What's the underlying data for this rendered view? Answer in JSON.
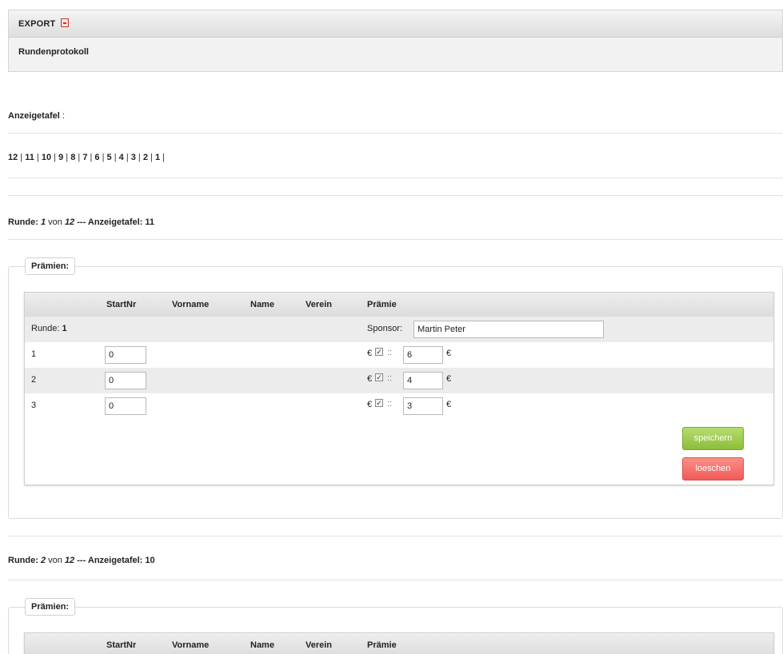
{
  "export": {
    "title": "EXPORT",
    "icon": "pdf-icon",
    "item": "Rundenprotokoll"
  },
  "anzeigetafel": {
    "label": "Anzeigetafel",
    "suffix": " :",
    "numbers": [
      "12",
      "11",
      "10",
      "9",
      "8",
      "7",
      "6",
      "5",
      "4",
      "3",
      "2",
      "1"
    ],
    "separator": " | "
  },
  "rounds": [
    {
      "runde_label": "Runde: ",
      "runde_num": "1",
      "von": " von ",
      "total": "12",
      "dash": " --- ",
      "tafel_label": "Anzeigetafel: ",
      "tafel_num": "11",
      "legend": "Prämien:",
      "columns": [
        "StartNr",
        "Vorname",
        "Name",
        "Verein",
        "Prämie"
      ],
      "round_row_label": "Runde: ",
      "round_row_num": "1",
      "sponsor_label": "Sponsor:",
      "sponsor_value": "Martin Peter",
      "rows": [
        {
          "place": "1",
          "startnr": "0",
          "euro": "€",
          "checked": true,
          "colon": "::",
          "amount": "6",
          "unit": "€"
        },
        {
          "place": "2",
          "startnr": "0",
          "euro": "€",
          "checked": true,
          "colon": "::",
          "amount": "4",
          "unit": "€"
        },
        {
          "place": "3",
          "startnr": "0",
          "euro": "€",
          "checked": true,
          "colon": "::",
          "amount": "3",
          "unit": "€"
        }
      ],
      "save_label": "speichern",
      "delete_label": "loeschen"
    },
    {
      "runde_label": "Runde: ",
      "runde_num": "2",
      "von": " von ",
      "total": "12",
      "dash": " --- ",
      "tafel_label": "Anzeigetafel: ",
      "tafel_num": "10",
      "legend": "Prämien:",
      "columns": [
        "StartNr",
        "Vorname",
        "Name",
        "Verein",
        "Prämie"
      ]
    }
  ],
  "colors": {
    "save_button": "#9ccc4c",
    "delete_button": "#f26a65",
    "header_gray": "#dcdcdc"
  }
}
